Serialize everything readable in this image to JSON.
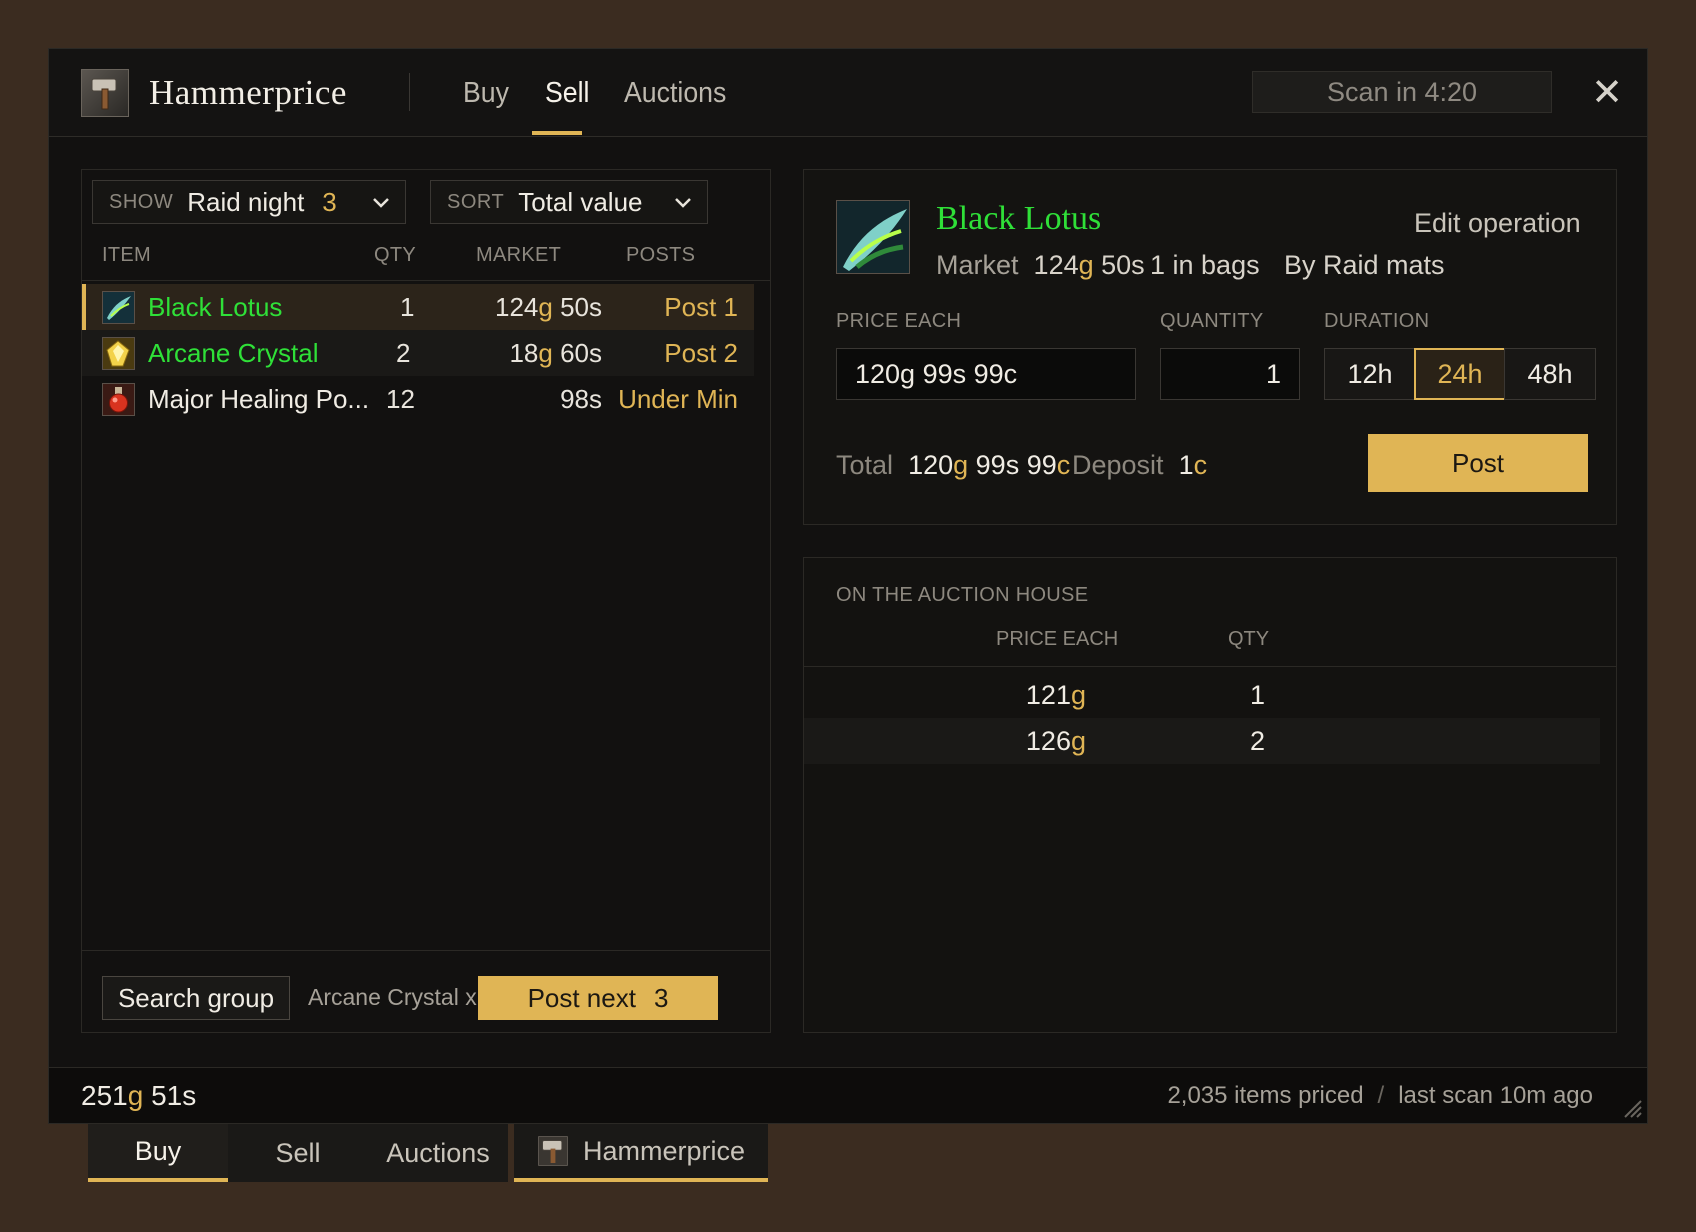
{
  "window": {
    "title": "Hammerprice",
    "tabs": [
      "Buy",
      "Sell",
      "Auctions"
    ],
    "active_tab": "Sell",
    "scan_countdown": "Scan in 4:20",
    "close_glyph": "✕"
  },
  "filters": {
    "show_label": "SHOW",
    "show_value": "Raid night",
    "show_count": "3",
    "sort_label": "SORT",
    "sort_value": "Total value"
  },
  "item_list": {
    "columns": [
      "ITEM",
      "QTY",
      "MARKET",
      "POSTS"
    ],
    "rows": [
      {
        "name": "Black Lotus",
        "qty": "1",
        "market_g": "124",
        "market_rest": " 50s",
        "post": "Post 1",
        "selected": true,
        "icon": "black-lotus-icon"
      },
      {
        "name": "Arcane Crystal",
        "qty": "2",
        "market_g": "18",
        "market_rest": " 60s",
        "post": "Post 2",
        "selected": false,
        "icon": "arcane-crystal-icon"
      },
      {
        "name": "Major Healing Po...",
        "qty": "12",
        "market_g": "",
        "market_rest": "98s",
        "post": "Under Min",
        "selected": false,
        "icon": "healing-potion-icon"
      }
    ],
    "search_group_label": "Search group",
    "next_item_label": "Arcane Crystal x...",
    "post_next_label": "Post next",
    "post_next_count": "3"
  },
  "detail": {
    "name": "Black Lotus",
    "edit_label": "Edit operation",
    "market_label": "Market",
    "market_g": "124",
    "market_rest": " 50s",
    "bags": "1 in bags",
    "group": "By Raid mats",
    "price_label": "PRICE EACH",
    "price_value": "120g 99s 99c",
    "quantity_label": "QUANTITY",
    "quantity_value": "1",
    "duration_label": "DURATION",
    "durations": [
      "12h",
      "24h",
      "48h"
    ],
    "active_duration": "24h",
    "total_label": "Total",
    "total_g": "120",
    "total_mid": " 99s 99",
    "deposit_label": "Deposit",
    "deposit_value": "1",
    "post_label": "Post"
  },
  "auction_house": {
    "title": "ON THE AUCTION HOUSE",
    "columns": [
      "PRICE EACH",
      "QTY"
    ],
    "rows": [
      {
        "price_g": "121",
        "qty": "1"
      },
      {
        "price_g": "126",
        "qty": "2"
      }
    ]
  },
  "status": {
    "gold_g": "251",
    "gold_rest": " 51s",
    "items_priced": "2,035 items priced",
    "separator": "/",
    "last_scan": "last scan 10m ago"
  },
  "bottom_tabs": [
    "Buy",
    "Sell",
    "Auctions",
    "Hammerprice"
  ],
  "units": {
    "gold": "g",
    "copper": "c"
  },
  "colors": {
    "accent": "#e0b555",
    "uncommon": "#2fe038",
    "background": "#3b2c20",
    "panel": "#121110"
  }
}
